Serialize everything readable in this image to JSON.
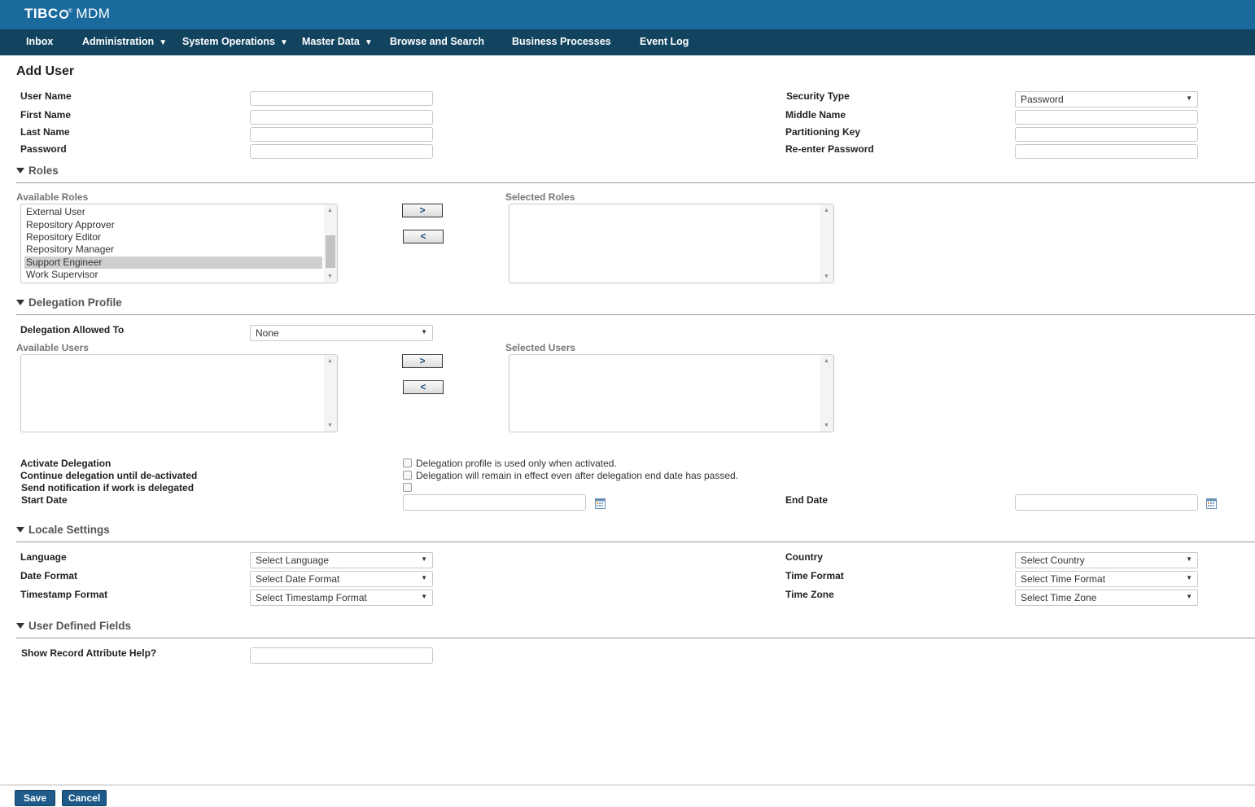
{
  "app": {
    "brand": "TIBC",
    "brand_suffix": "MDM"
  },
  "nav": {
    "inbox": "Inbox",
    "administration": "Administration",
    "system_operations": "System Operations",
    "master_data": "Master Data",
    "browse_search": "Browse and Search",
    "business_processes": "Business Processes",
    "event_log": "Event Log"
  },
  "page": {
    "title": "Add User"
  },
  "user_form": {
    "user_name": "User Name",
    "first_name": "First Name",
    "last_name": "Last Name",
    "password": "Password",
    "security_type": "Security Type",
    "security_type_value": "Password",
    "middle_name": "Middle Name",
    "partitioning_key": "Partitioning Key",
    "reenter_password": "Re-enter Password"
  },
  "roles": {
    "heading": "Roles",
    "available_label": "Available Roles",
    "selected_label": "Selected Roles",
    "add_btn": ">",
    "remove_btn": "<",
    "available": [
      "External User",
      "Repository Approver",
      "Repository Editor",
      "Repository Manager",
      "Support Engineer",
      "Work Supervisor"
    ],
    "highlighted": "Support Engineer"
  },
  "delegation": {
    "heading": "Delegation Profile",
    "allowed_to_label": "Delegation Allowed To",
    "allowed_to_value": "None",
    "available_users_label": "Available Users",
    "selected_users_label": "Selected Users",
    "add_btn": ">",
    "remove_btn": "<",
    "activate_label": "Activate Delegation",
    "activate_desc": "Delegation profile is used only when activated.",
    "continue_label": "Continue delegation until de-activated",
    "continue_desc": "Delegation will remain in effect even after delegation end date has passed.",
    "notify_label": "Send notification if work is delegated",
    "start_date_label": "Start Date",
    "end_date_label": "End Date"
  },
  "locale": {
    "heading": "Locale Settings",
    "language_label": "Language",
    "language_value": "Select Language",
    "date_format_label": "Date Format",
    "date_format_value": "Select Date Format",
    "timestamp_format_label": "Timestamp Format",
    "timestamp_format_value": "Select Timestamp Format",
    "country_label": "Country",
    "country_value": "Select Country",
    "time_format_label": "Time Format",
    "time_format_value": "Select Time Format",
    "time_zone_label": "Time Zone",
    "time_zone_value": "Select Time Zone"
  },
  "udf": {
    "heading": "User Defined Fields",
    "show_help_label": "Show Record Attribute Help?"
  },
  "footer": {
    "save": "Save",
    "cancel": "Cancel"
  },
  "colors": {
    "header": "#1a6a9e",
    "nav": "#12445f",
    "button": "#1e5b8a"
  }
}
